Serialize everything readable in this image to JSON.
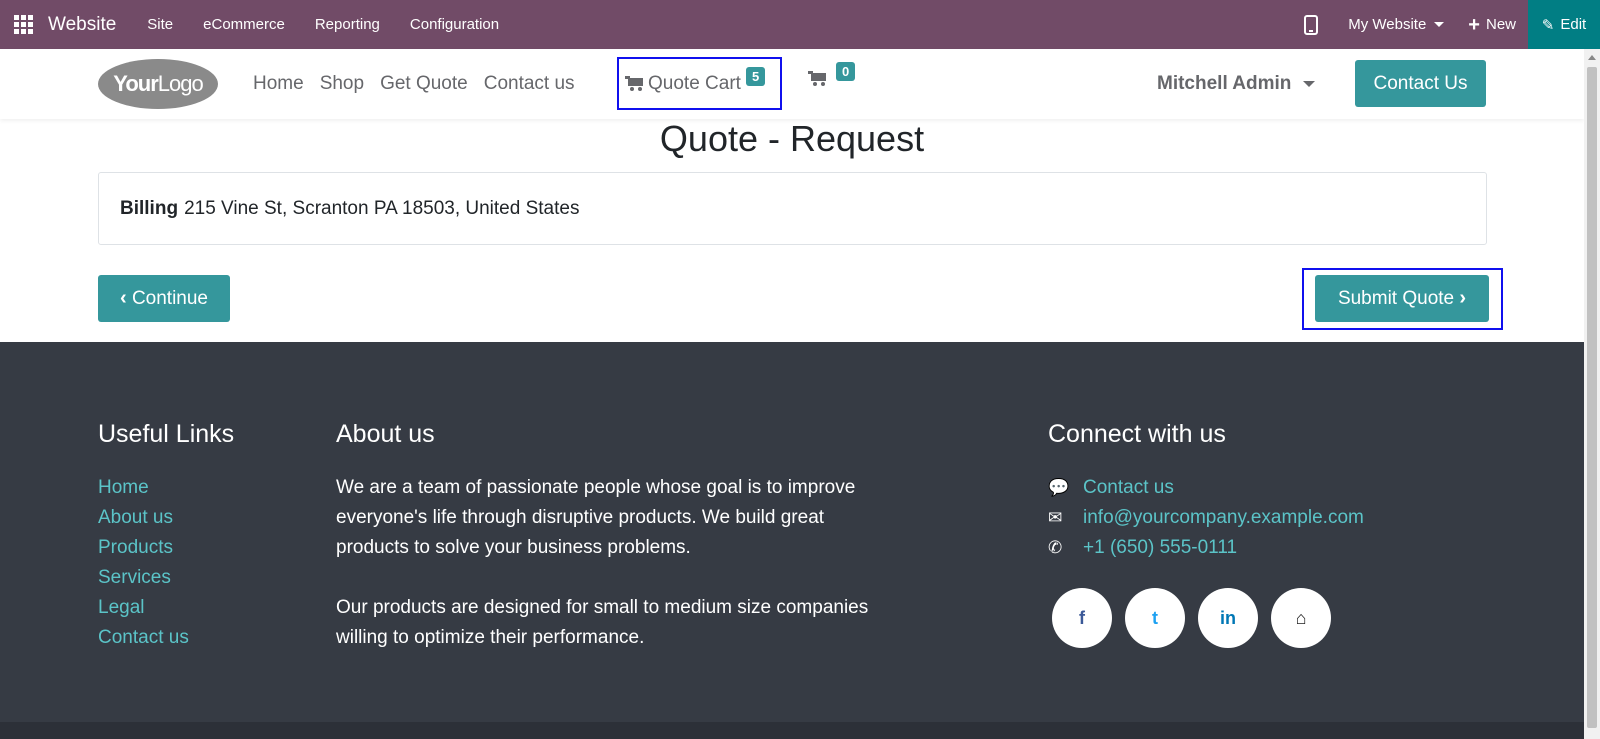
{
  "topbar": {
    "app_name": "Website",
    "menu": [
      "Site",
      "eCommerce",
      "Reporting",
      "Configuration"
    ],
    "website_selector": "My Website",
    "new_label": "New",
    "edit_label": "Edit",
    "bg_color": "#714B67",
    "edit_bg_color": "#017E84"
  },
  "header": {
    "logo_text_bold": "Your",
    "logo_text_light": "Logo",
    "nav": [
      "Home",
      "Shop",
      "Get Quote",
      "Contact us"
    ],
    "quote_cart_label": "Quote Cart",
    "quote_cart_count": "5",
    "cart_count": "0",
    "user_name": "Mitchell Admin",
    "contact_button": "Contact Us",
    "accent_color": "#35979c"
  },
  "main": {
    "title": "Quote - Request",
    "billing_label": "Billing",
    "billing_address": "215 Vine St, Scranton PA 18503, United States",
    "continue_label": "Continue",
    "submit_label": "Submit Quote"
  },
  "footer": {
    "links_heading": "Useful Links",
    "links": [
      "Home",
      "About us",
      "Products",
      "Services",
      "Legal",
      "Contact us"
    ],
    "about_heading": "About us",
    "about_p1": "We are a team of passionate people whose goal is to improve everyone's life through disruptive products. We build great products to solve your business problems.",
    "about_p2": "Our products are designed for small to medium size companies willing to optimize their performance.",
    "connect_heading": "Connect with us",
    "connect": [
      {
        "icon": "comment-icon",
        "text": "Contact us"
      },
      {
        "icon": "envelope-icon",
        "text": "info@yourcompany.example.com"
      },
      {
        "icon": "phone-icon",
        "text": "+1 (650) 555-0111"
      }
    ],
    "socials": [
      {
        "icon": "facebook-icon",
        "glyph": "f",
        "color": "#3b5998"
      },
      {
        "icon": "twitter-icon",
        "glyph": "t",
        "color": "#1da1f2"
      },
      {
        "icon": "linkedin-icon",
        "glyph": "in",
        "color": "#0077b5"
      },
      {
        "icon": "home-icon",
        "glyph": "⌂",
        "color": "#222222"
      }
    ],
    "link_color": "#5bc4c8",
    "bg_color": "#363b44"
  }
}
